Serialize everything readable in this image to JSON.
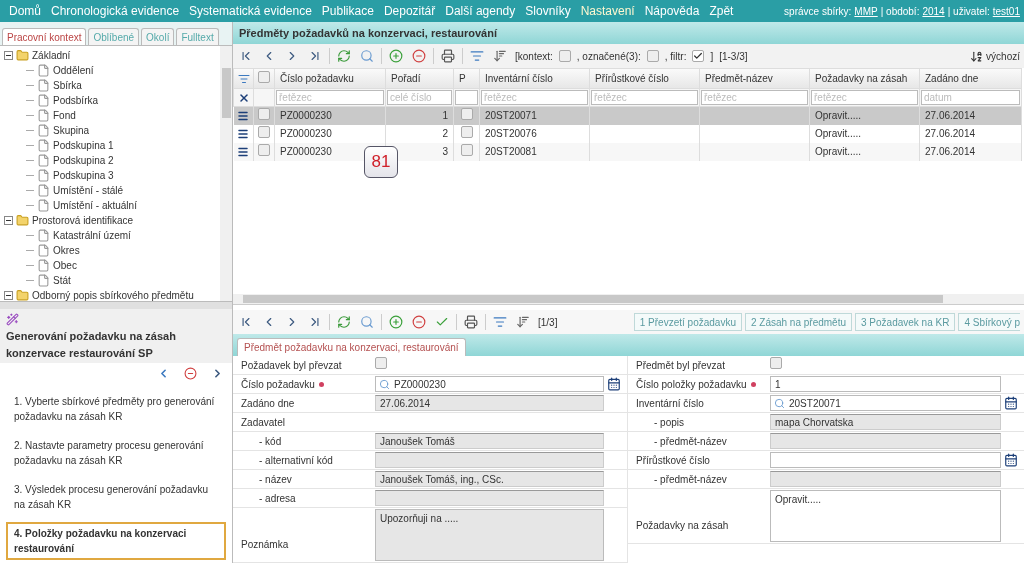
{
  "nav": {
    "items": [
      {
        "label": "Domů",
        "selected": false
      },
      {
        "label": "Chronologická evidence",
        "selected": false
      },
      {
        "label": "Systematická evidence",
        "selected": false
      },
      {
        "label": "Publikace",
        "selected": false
      },
      {
        "label": "Depozitář",
        "selected": false
      },
      {
        "label": "Další agendy",
        "selected": false
      },
      {
        "label": "Slovníky",
        "selected": false
      },
      {
        "label": "Nastavení",
        "selected": true
      },
      {
        "label": "Nápověda",
        "selected": false
      },
      {
        "label": "Zpět",
        "selected": false
      }
    ],
    "user_info": [
      {
        "label": "správce sbírky:",
        "link": "MMP"
      },
      {
        "label": "| období:",
        "link": "2014"
      },
      {
        "label": "| uživatel:",
        "link": "test01"
      }
    ]
  },
  "left_tabs": [
    {
      "label": "Pracovní kontext",
      "selected": true
    },
    {
      "label": "Oblíbené",
      "selected": false
    },
    {
      "label": "Okolí",
      "selected": false
    },
    {
      "label": "Fulltext",
      "selected": false
    }
  ],
  "tree": [
    {
      "label": "Základní",
      "expanded": true,
      "children": [
        {
          "label": "Oddělení"
        },
        {
          "label": "Sbírka"
        },
        {
          "label": "Podsbírka"
        },
        {
          "label": "Fond"
        },
        {
          "label": "Skupina"
        },
        {
          "label": "Podskupina 1"
        },
        {
          "label": "Podskupina 2"
        },
        {
          "label": "Podskupina 3"
        },
        {
          "label": "Umístění - stálé"
        },
        {
          "label": "Umístění - aktuální"
        }
      ]
    },
    {
      "label": "Prostorová identifikace",
      "expanded": true,
      "children": [
        {
          "label": "Katastrální území"
        },
        {
          "label": "Okres"
        },
        {
          "label": "Obec"
        },
        {
          "label": "Stát"
        }
      ]
    },
    {
      "label": "Odborný popis sbírkového předmětu",
      "expanded": true
    }
  ],
  "wizard": {
    "title": "Generování požadavku na zásah konzervace restaurování SP",
    "steps": [
      {
        "label": "1. Vyberte sbírkové předměty pro generování požadavku na zásah KR",
        "selected": false
      },
      {
        "label": "2. Nastavte parametry procesu generování požadavku na zásah KR",
        "selected": false
      },
      {
        "label": "3. Výsledek procesu generování požadavku na zásah KR",
        "selected": false
      },
      {
        "label": "4. Položky požadavku na konzervaci restaurování",
        "selected": true
      }
    ]
  },
  "grid": {
    "title": "Předměty požadavků na konzervaci, restaurování",
    "context_filters": [
      {
        "label": "[kontext:",
        "checked": false
      },
      {
        "label": ", označené(3):",
        "checked": false
      },
      {
        "label": ", filtr:",
        "checked": true
      }
    ],
    "filters_end": "]",
    "count": "[1-3/3]",
    "sort": "výchozí",
    "header_checked": false,
    "columns": [
      {
        "label": "Číslo požadavku",
        "placeholder": "řetězec"
      },
      {
        "label": "Pořadí",
        "placeholder": "celé číslo"
      },
      {
        "label": "P"
      },
      {
        "label": "Inventární číslo",
        "placeholder": "řetězec"
      },
      {
        "label": "Přírůstkové číslo",
        "placeholder": "řetězec"
      },
      {
        "label": "Předmět-název",
        "placeholder": "řetězec"
      },
      {
        "label": "Požadavky na zásah",
        "placeholder": "řetězec"
      },
      {
        "label": "Zadáno dne",
        "placeholder": "datum"
      }
    ],
    "rows": [
      {
        "selected": true,
        "checked": false,
        "p": false,
        "cells": [
          "PZ0000230",
          "1",
          "",
          "20ST20071",
          "",
          "",
          "Opravit.....",
          "27.06.2014"
        ]
      },
      {
        "selected": false,
        "checked": false,
        "p": false,
        "cells": [
          "PZ0000230",
          "2",
          "",
          "20ST20076",
          "",
          "",
          "Opravit.....",
          "27.06.2014"
        ]
      },
      {
        "selected": false,
        "checked": false,
        "p": false,
        "cells": [
          "PZ0000230",
          "3",
          "",
          "20ST20081",
          "",
          "",
          "Opravit.....",
          "27.06.2014"
        ]
      }
    ],
    "badge": "81"
  },
  "detail": {
    "count": "[1/3]",
    "step_buttons": [
      "1 Převzetí požadavku",
      "2 Zásah na předmětu",
      "3 Požadavek na KR",
      "4 Sbírkový p"
    ],
    "tab": "Předmět požadavku na konzervaci, restaurování",
    "left": [
      {
        "kind": "checkbox",
        "label": "Požadavek byl převzat",
        "checked": false
      },
      {
        "kind": "lookup",
        "label": "Číslo požadavku",
        "required": true,
        "value": "PZ0000230"
      },
      {
        "kind": "readonly",
        "label": "Zadáno dne",
        "value": "27.06.2014"
      },
      {
        "kind": "heading",
        "label": "Zadavatel",
        "children": [
          {
            "kind": "readonly",
            "label": "- kód",
            "value": "Janoušek Tomáš"
          },
          {
            "kind": "readonly",
            "label": "- alternativní kód"
          },
          {
            "kind": "readonly",
            "label": "- název",
            "value": "Janoušek Tomáš, ing., CSc."
          },
          {
            "kind": "readonly",
            "label": "- adresa"
          }
        ]
      },
      {
        "kind": "textarea",
        "label": "Poznámka",
        "readonly": true,
        "value": "Upozorňuji na ....."
      }
    ],
    "right": [
      {
        "kind": "checkbox",
        "label": "Předmět byl převzat",
        "checked": false
      },
      {
        "kind": "input",
        "label": "Číslo položky požadavku",
        "required": true,
        "value": "1"
      },
      {
        "kind": "lookup",
        "label": "Inventární číslo",
        "value": "20ST20071",
        "children": [
          {
            "kind": "readonly",
            "label": "- popis",
            "value": "mapa Chorvatska"
          },
          {
            "kind": "readonly",
            "label": "- předmět-název"
          }
        ]
      },
      {
        "kind": "picker",
        "label": "Přírůstkové číslo",
        "children": [
          {
            "kind": "readonly",
            "label": "- předmět-název"
          }
        ]
      },
      {
        "kind": "textarea",
        "label": "Požadavky na zásah",
        "readonly": false,
        "value": "Opravit....."
      }
    ]
  }
}
